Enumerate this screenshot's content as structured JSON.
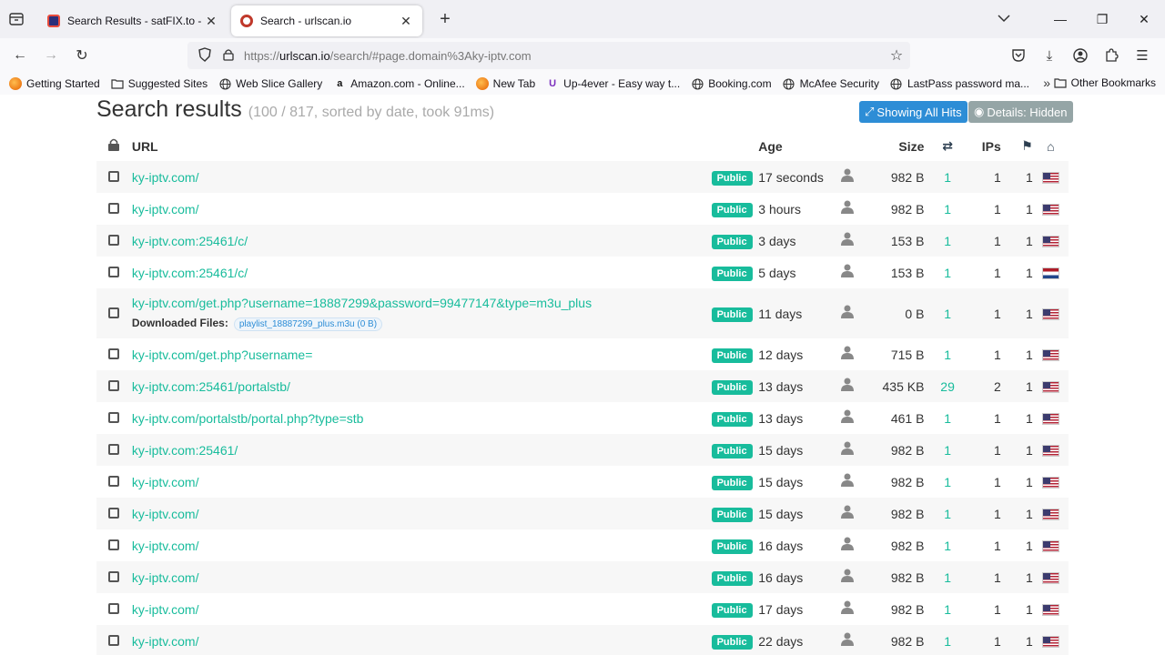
{
  "browser": {
    "tabs": [
      {
        "title": "Search Results - satFIX.to - FTA",
        "active": false
      },
      {
        "title": "Search - urlscan.io",
        "active": true
      }
    ],
    "url_prefix": "https://",
    "url_host": "urlscan.io",
    "url_path": "/search/#page.domain%3Aky-iptv.com",
    "bookmarks": [
      {
        "label": "Getting Started",
        "icon": "firefox-icon"
      },
      {
        "label": "Suggested Sites",
        "icon": "folder-icon"
      },
      {
        "label": "Web Slice Gallery",
        "icon": "globe-icon"
      },
      {
        "label": "Amazon.com - Online...",
        "icon": "amazon-icon"
      },
      {
        "label": "New Tab",
        "icon": "firefox-icon"
      },
      {
        "label": "Up-4ever - Easy way t...",
        "icon": "u-icon"
      },
      {
        "label": "Booking.com",
        "icon": "globe-icon"
      },
      {
        "label": "McAfee Security",
        "icon": "globe-icon"
      },
      {
        "label": "LastPass password ma...",
        "icon": "globe-icon"
      }
    ],
    "other_bookmarks": "Other Bookmarks"
  },
  "page": {
    "title": "Search results",
    "meta": "(100 / 817, sorted by date, took 91ms)",
    "showing_all_hits": "Showing All Hits",
    "details_hidden": "Details: Hidden",
    "columns": {
      "url": "URL",
      "age": "Age",
      "size": "Size",
      "ips": "IPs"
    },
    "rows": [
      {
        "url": "ky-iptv.com/",
        "badge": "Public",
        "age": "17 seconds",
        "size": "982 B",
        "links": "1",
        "ips": "1",
        "countries": "1",
        "flag": "us"
      },
      {
        "url": "ky-iptv.com/",
        "badge": "Public",
        "age": "3 hours",
        "size": "982 B",
        "links": "1",
        "ips": "1",
        "countries": "1",
        "flag": "us"
      },
      {
        "url": "ky-iptv.com:25461/c/",
        "badge": "Public",
        "age": "3 days",
        "size": "153 B",
        "links": "1",
        "ips": "1",
        "countries": "1",
        "flag": "us"
      },
      {
        "url": "ky-iptv.com:25461/c/",
        "badge": "Public",
        "age": "5 days",
        "size": "153 B",
        "links": "1",
        "ips": "1",
        "countries": "1",
        "flag": "nl"
      },
      {
        "url": "ky-iptv.com/get.php?username=18887299&password=99477147&type=m3u_plus",
        "badge": "Public",
        "age": "11 days",
        "size": "0 B",
        "links": "1",
        "ips": "1",
        "countries": "1",
        "flag": "us",
        "downloaded_label": "Downloaded Files:",
        "downloaded_file": "playlist_18887299_plus.m3u (0 B)"
      },
      {
        "url": "ky-iptv.com/get.php?username=",
        "badge": "Public",
        "age": "12 days",
        "size": "715 B",
        "links": "1",
        "ips": "1",
        "countries": "1",
        "flag": "us"
      },
      {
        "url": "ky-iptv.com:25461/portalstb/",
        "badge": "Public",
        "age": "13 days",
        "size": "435 KB",
        "links": "29",
        "ips": "2",
        "countries": "1",
        "flag": "us"
      },
      {
        "url": "ky-iptv.com/portalstb/portal.php?type=stb",
        "badge": "Public",
        "age": "13 days",
        "size": "461 B",
        "links": "1",
        "ips": "1",
        "countries": "1",
        "flag": "us"
      },
      {
        "url": "ky-iptv.com:25461/",
        "badge": "Public",
        "age": "15 days",
        "size": "982 B",
        "links": "1",
        "ips": "1",
        "countries": "1",
        "flag": "us"
      },
      {
        "url": "ky-iptv.com/",
        "badge": "Public",
        "age": "15 days",
        "size": "982 B",
        "links": "1",
        "ips": "1",
        "countries": "1",
        "flag": "us"
      },
      {
        "url": "ky-iptv.com/",
        "badge": "Public",
        "age": "15 days",
        "size": "982 B",
        "links": "1",
        "ips": "1",
        "countries": "1",
        "flag": "us"
      },
      {
        "url": "ky-iptv.com/",
        "badge": "Public",
        "age": "16 days",
        "size": "982 B",
        "links": "1",
        "ips": "1",
        "countries": "1",
        "flag": "us"
      },
      {
        "url": "ky-iptv.com/",
        "badge": "Public",
        "age": "16 days",
        "size": "982 B",
        "links": "1",
        "ips": "1",
        "countries": "1",
        "flag": "us"
      },
      {
        "url": "ky-iptv.com/",
        "badge": "Public",
        "age": "17 days",
        "size": "982 B",
        "links": "1",
        "ips": "1",
        "countries": "1",
        "flag": "us"
      },
      {
        "url": "ky-iptv.com/",
        "badge": "Public",
        "age": "22 days",
        "size": "982 B",
        "links": "1",
        "ips": "1",
        "countries": "1",
        "flag": "us"
      }
    ]
  },
  "colors": {
    "accent": "#18bc9c",
    "primary_button": "#2d8dd6",
    "secondary_button": "#95a5a6"
  }
}
